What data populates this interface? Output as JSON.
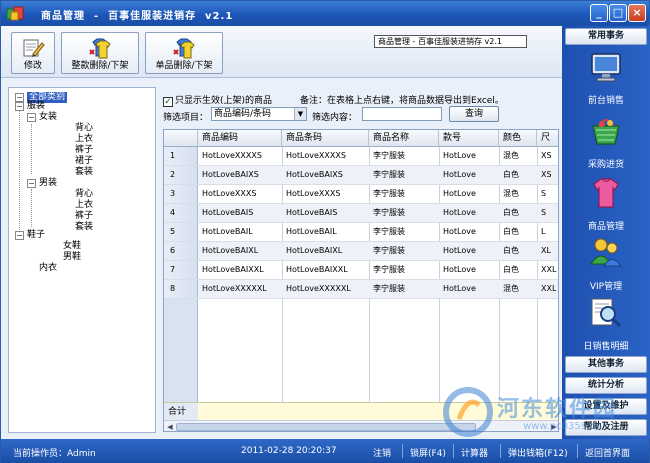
{
  "window": {
    "title": "商品管理  -  百事佳服装进销存  v2.1",
    "buttons": {
      "minimize": "_",
      "maximize": "□",
      "close": "×"
    }
  },
  "toolbar": {
    "modify_label": "修改",
    "bulk_delete_label": "整款删除/下架",
    "single_delete_label": "单品删除/下架",
    "header_caption": "商品管理 - 百事佳服装进销存 v2.1"
  },
  "tree": {
    "root": "全部类别",
    "nodes": [
      {
        "label": "服装",
        "level": 1,
        "box": "-"
      },
      {
        "label": "女装",
        "level": 2,
        "box": "-"
      },
      {
        "label": "背心",
        "level": 3
      },
      {
        "label": "上衣",
        "level": 3
      },
      {
        "label": "裤子",
        "level": 3
      },
      {
        "label": "裙子",
        "level": 3
      },
      {
        "label": "套装",
        "level": 3
      },
      {
        "label": "男装",
        "level": 2,
        "box": "-"
      },
      {
        "label": "背心",
        "level": 3
      },
      {
        "label": "上衣",
        "level": 3
      },
      {
        "label": "裤子",
        "level": 3
      },
      {
        "label": "套装",
        "level": 3
      },
      {
        "label": "鞋子",
        "level": 1,
        "box": "-"
      },
      {
        "label": "女鞋",
        "level": 3
      },
      {
        "label": "男鞋",
        "level": 3
      },
      {
        "label": "内衣",
        "level": 2
      }
    ]
  },
  "filters": {
    "only_active_label": "只显示生效(上架)的商品",
    "only_active_checked": "✓",
    "note": "备注：在表格上点右键，将商品数据导出到Excel。",
    "filter_item_label": "筛选项目：",
    "filter_item_value": "商品编码/条码",
    "filter_content_label": "筛选内容：",
    "filter_content_value": "",
    "query_button": "查询"
  },
  "grid": {
    "columns": [
      "商品编码",
      "商品条码",
      "商品名称",
      "款号",
      "颜色",
      "尺"
    ],
    "rows": [
      {
        "n": "1",
        "cells": [
          "HotLoveXXXXS",
          "HotLoveXXXXS",
          "李宁服装",
          "HotLove",
          "混色",
          "XS"
        ]
      },
      {
        "n": "2",
        "cells": [
          "HotLoveBAIXS",
          "HotLoveBAIXS",
          "李宁服装",
          "HotLove",
          "白色",
          "XS"
        ]
      },
      {
        "n": "3",
        "cells": [
          "HotLoveXXXS",
          "HotLoveXXXS",
          "李宁服装",
          "HotLove",
          "混色",
          "S"
        ]
      },
      {
        "n": "4",
        "cells": [
          "HotLoveBAIS",
          "HotLoveBAIS",
          "李宁服装",
          "HotLove",
          "白色",
          "S"
        ]
      },
      {
        "n": "5",
        "cells": [
          "HotLoveBAIL",
          "HotLoveBAIL",
          "李宁服装",
          "HotLove",
          "白色",
          "L"
        ]
      },
      {
        "n": "6",
        "cells": [
          "HotLoveBAIXL",
          "HotLoveBAIXL",
          "李宁服装",
          "HotLove",
          "白色",
          "XL"
        ]
      },
      {
        "n": "7",
        "cells": [
          "HotLoveBAIXXL",
          "HotLoveBAIXXL",
          "李宁服装",
          "HotLove",
          "白色",
          "XXL"
        ]
      },
      {
        "n": "8",
        "cells": [
          "HotLoveXXXXXL",
          "HotLoveXXXXXL",
          "李宁服装",
          "HotLove",
          "混色",
          "XXL"
        ]
      }
    ],
    "total_label": "合计"
  },
  "sidebar": {
    "common_tab": "常用事务",
    "items": [
      {
        "label": "前台销售",
        "icon": "monitor-icon"
      },
      {
        "label": "采购进货",
        "icon": "basket-icon"
      },
      {
        "label": "商品管理",
        "icon": "shirt-icon"
      },
      {
        "label": "VIP管理",
        "icon": "users-icon"
      },
      {
        "label": "日销售明细",
        "icon": "magnifier-icon"
      }
    ],
    "other_tab": "其他事务",
    "stats_tab": "统计分析",
    "settings_tab": "设置及维护",
    "help_tab": "帮助及注册"
  },
  "status": {
    "operator": "当前操作员：Admin",
    "datetime": "2011-02-28 20:20:37",
    "logout": "注销",
    "lock": "锁屏(F4)",
    "calculator": "计算器",
    "cash_drawer": "弹出钱箱(F12)",
    "home": "返回首界面"
  },
  "watermark": {
    "text": "河东软件园",
    "url": "www.pc0359.cn"
  },
  "colors": {
    "titlebar": "#1d56b8",
    "sidebar": "#2a64c6",
    "selection": "#2f5fc3",
    "total_row": "#fffbd8"
  }
}
